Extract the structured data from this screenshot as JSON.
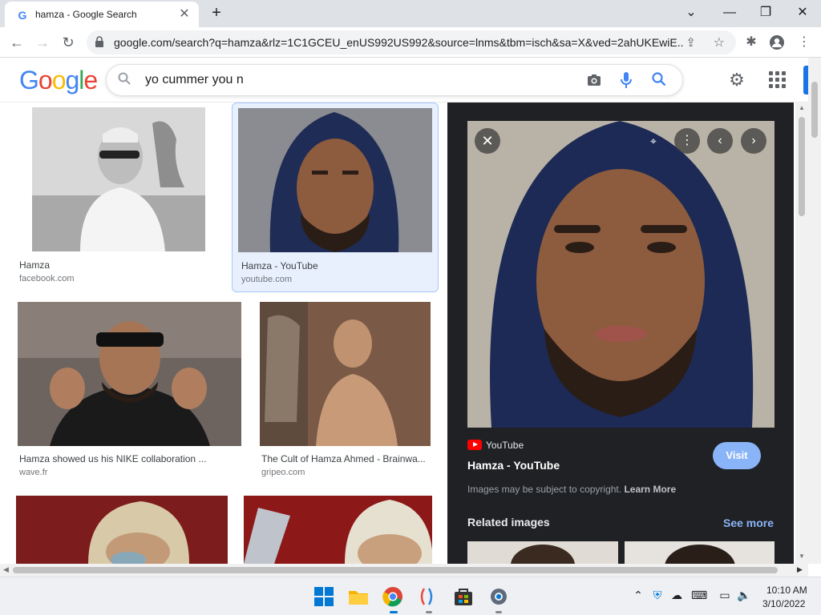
{
  "browser": {
    "tab_title": "hamza - Google Search",
    "new_tab": "+",
    "url": "google.com/search?q=hamza&rlz=1C1GCEU_enUS992US992&source=lnms&tbm=isch&sa=X&ved=2ahUKEwiE..."
  },
  "google": {
    "logo": "Google",
    "search_query": "yo cummer you n"
  },
  "results": [
    {
      "title": "Hamza",
      "source": "facebook.com"
    },
    {
      "title": "Hamza - YouTube",
      "source": "youtube.com"
    },
    {
      "title": "Hamza showed us his NIKE collaboration ...",
      "source": "wave.fr"
    },
    {
      "title": "The Cult of Hamza Ahmed - Brainwa...",
      "source": "gripeo.com"
    }
  ],
  "preview": {
    "source": "YouTube",
    "title": "Hamza - YouTube",
    "visit": "Visit",
    "copyright": "Images may be subject to copyright.",
    "learn_more": "Learn More",
    "related": "Related images",
    "see_more": "See more"
  },
  "taskbar": {
    "time": "10:10 AM",
    "date": "3/10/2022"
  },
  "colors": {
    "accent": "#1a73e8",
    "visit_button": "#8ab4f8",
    "preview_bg": "#202124",
    "youtube_red": "#ff0000"
  },
  "icons": [
    "google-favicon",
    "close-icon",
    "back-icon",
    "forward-icon",
    "reload-icon",
    "lock-icon",
    "share-icon",
    "star-icon",
    "extensions-icon",
    "profile-icon",
    "menu-icon",
    "search-icon",
    "camera-icon",
    "mic-icon",
    "gear-icon",
    "apps-icon",
    "youtube-icon",
    "chevron-left-icon",
    "chevron-right-icon",
    "more-icon",
    "lens-icon"
  ]
}
